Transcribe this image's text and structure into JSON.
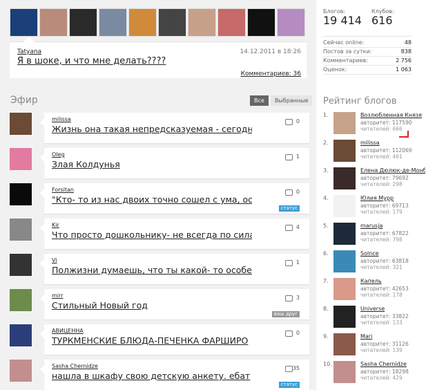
{
  "top_avatars": [
    {
      "icon": "user-avatar",
      "color": "#1b3f78"
    },
    {
      "icon": "user-avatar",
      "color": "#b98b7a"
    },
    {
      "icon": "user-avatar",
      "color": "#2a2a2a"
    },
    {
      "icon": "user-avatar",
      "color": "#7a8aa0"
    },
    {
      "icon": "user-avatar",
      "color": "#d18a3c"
    },
    {
      "icon": "user-avatar",
      "color": "#444444"
    },
    {
      "icon": "user-avatar",
      "color": "#c7a08a"
    },
    {
      "icon": "user-avatar",
      "color": "#c76a6a"
    },
    {
      "icon": "user-avatar",
      "color": "#111111"
    },
    {
      "icon": "user-avatar",
      "color": "#b48cc2"
    }
  ],
  "featured": {
    "author": "Tatyana",
    "date": "14.12.2011 в 18:26",
    "title": "Я в шоке, и что мне делать????",
    "comments": "Комментариев: 36"
  },
  "ether": {
    "title": "Эфир",
    "tab_all": "Все",
    "tab_fav": "Выбранные"
  },
  "feed": [
    {
      "author": "milissa",
      "title": "Жизнь она такая непредсказуемая - сегодня",
      "comments": "0",
      "badge": "",
      "avatar_color": "#6b4a36"
    },
    {
      "author": "Oleg",
      "title": "Злая Колдунья",
      "comments": "1",
      "badge": "",
      "avatar_color": "#e37ba0"
    },
    {
      "author": "Forsitan",
      "title": "\"Кто- то из нас двоих точно сошел с ума, ос",
      "comments": "0",
      "badge": "статус",
      "avatar_color": "#0a0a0a"
    },
    {
      "author": "Kir",
      "title": "Что просто дошкольнику- не всегда по сила",
      "comments": "4",
      "badge": "",
      "avatar_color": "#888888"
    },
    {
      "author": "Vi",
      "title": "Полжизни думаешь, что ты какой- то особен",
      "comments": "1",
      "badge": "",
      "avatar_color": "#333333"
    },
    {
      "author": "mirr",
      "title": "Стильный Новый год",
      "comments": "3",
      "badge": "ваш друг",
      "avatar_color": "#6c8c4c"
    },
    {
      "author": "АВИЦЕННА",
      "title": "ТУРКМЕНСКИЕ БЛЮДА-ПЕЧЕНКА ФАРШИРО",
      "comments": "0",
      "badge": "",
      "avatar_color": "#2c3e7a"
    },
    {
      "author": "Sasha Chernidze",
      "title": "нашла в шкафу свою детскую анкету. ебат",
      "comments": "35",
      "badge": "статус",
      "avatar_color": "#c28e8e"
    }
  ],
  "stats": {
    "blogs_label": "Блогов:",
    "blogs_value": "19 414",
    "clubs_label": "Клубов:",
    "clubs_value": "616",
    "rows": [
      {
        "label": "Сейчас online:",
        "value": "48"
      },
      {
        "label": "Постов за сутки:",
        "value": "838"
      },
      {
        "label": "Комментариев:",
        "value": "2 756"
      },
      {
        "label": "Оценок:",
        "value": "1 063"
      }
    ]
  },
  "rating": {
    "title": "Рейтинг блогов",
    "items": [
      {
        "num": "1.",
        "name": "Возлюбленная Князя",
        "authority": "авторитет: 117590",
        "readers": "читателей: 666",
        "avatar_color": "#c7a28a"
      },
      {
        "num": "2.",
        "name": "milissa",
        "authority": "авторитет: 112069",
        "readers": "читателей: 461",
        "avatar_color": "#6b4a36"
      },
      {
        "num": "3.",
        "name": "Елена Дюлюк-де-Монбейар",
        "authority": "авторитет: 79692",
        "readers": "читателей: 298",
        "avatar_color": "#3a2a2a"
      },
      {
        "num": "4.",
        "name": "Юлия Мурр",
        "authority": "авторитет: 69713",
        "readers": "читателей: 179",
        "avatar_color": "#f2f2f2"
      },
      {
        "num": "5.",
        "name": "marusja",
        "authority": "авторитет: 67822",
        "readers": "читателей: 798",
        "avatar_color": "#1e2a3a"
      },
      {
        "num": "6.",
        "name": "Solnce",
        "authority": "авторитет: 63818",
        "readers": "читателей: 321",
        "avatar_color": "#3a8ab8"
      },
      {
        "num": "7.",
        "name": "Капель",
        "authority": "авторитет: 42653",
        "readers": "читателей: 178",
        "avatar_color": "#d99a8a"
      },
      {
        "num": "8.",
        "name": "Universe",
        "authority": "авторитет: 33822",
        "readers": "читателей: 133",
        "avatar_color": "#222222"
      },
      {
        "num": "9.",
        "name": "Mari",
        "authority": "авторитет: 31126",
        "readers": "читателей: 139",
        "avatar_color": "#8a5a4a"
      },
      {
        "num": "10.",
        "name": "Sasha Chernidze",
        "authority": "авторитет: 18298",
        "readers": "читателей: 429",
        "avatar_color": "#c28e8e"
      }
    ]
  }
}
